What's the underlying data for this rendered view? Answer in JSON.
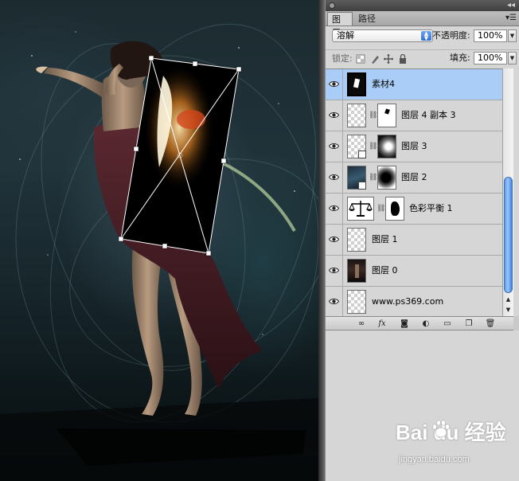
{
  "panel": {
    "tabs": [
      {
        "label": "图层",
        "active": true
      },
      {
        "label": "路径",
        "active": false
      }
    ],
    "blend_mode": "溶解",
    "opacity_label": "不透明度:",
    "opacity_value": "100%",
    "lock_label": "锁定:",
    "fill_label": "填充:",
    "fill_value": "100%"
  },
  "layers": [
    {
      "name": "素材4",
      "visible": true,
      "selected": true,
      "thumb": "dark-with-white-figure",
      "mask": false
    },
    {
      "name": "图层 4 副本 3",
      "visible": true,
      "selected": false,
      "thumb": "transparent",
      "mask": true
    },
    {
      "name": "图层 3",
      "visible": true,
      "selected": false,
      "thumb": "smart-object",
      "mask": true
    },
    {
      "name": "图层 2",
      "visible": true,
      "selected": false,
      "thumb": "smart-object-dark",
      "mask": true
    },
    {
      "name": "色彩平衡 1",
      "visible": true,
      "selected": false,
      "thumb": "adjustment-balance",
      "mask": true
    },
    {
      "name": "图层 1",
      "visible": true,
      "selected": false,
      "thumb": "transparent",
      "mask": false
    },
    {
      "name": "图层 0",
      "visible": true,
      "selected": false,
      "thumb": "photo-dark",
      "mask": false
    },
    {
      "name": "www.ps369.com",
      "visible": true,
      "selected": false,
      "thumb": "transparent",
      "mask": false
    }
  ],
  "bottom_icons": [
    "link-icon",
    "fx-icon",
    "mask-icon",
    "adjustment-icon",
    "group-folder-icon",
    "new-layer-icon",
    "trash-icon"
  ],
  "watermark": {
    "logo_text": "Bai du 经验",
    "url": "jingyan.baidu.com"
  },
  "colors": {
    "selection": "#a9cdf6",
    "scroll_accent": "#4a8fe6",
    "panel_bg": "#d6d6d6"
  }
}
